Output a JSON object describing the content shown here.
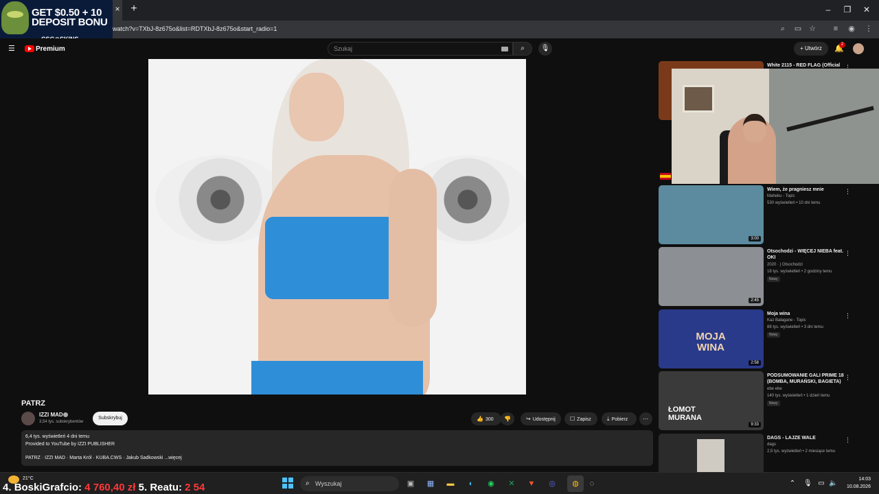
{
  "browser": {
    "url": "watch?v=TXbJ-8z675o&list=RDTXbJ-8z675o&start_radio=1",
    "new_tab_label": "+",
    "close_label": "×"
  },
  "ad": {
    "line1": "GET $0.50 + 10",
    "line2": "DEPOSIT BONU",
    "brand": "CSG⊙SKINS"
  },
  "yt_header": {
    "brand_label": "Premium",
    "search_placeholder": "Szukaj",
    "create_label": "+ Utwórz",
    "notifications_count": "2"
  },
  "video": {
    "title": "PATRZ",
    "channel": "IZZI MAD",
    "subscribers": "3,54 tys. subskrybentów",
    "subscribe_label": "Subskrybuj",
    "likes": "300",
    "share_label": "Udostępnij",
    "save_label": "Zapisz",
    "download_label": "Pobierz"
  },
  "description": {
    "line1": "6,4 tys. wyświetleń  4 dni temu",
    "line2": "Provided to YouTube by IZZI PUBLISHER",
    "line3": "PATRZ · IZZI MAD · Marta Król · KUBA.CWS · Jakub Sadkowski  ...więcej"
  },
  "sidebar": [
    {
      "title": "White 2115 - RED FLAG (Official",
      "channel": "",
      "meta": "",
      "duration": "",
      "new": "",
      "thumb_color": "#7a3a1a"
    },
    {
      "title": "Wiem, że pragniesz mnie",
      "channel": "Maheku - Topic",
      "meta": "530 wyświetleń • 10 dni temu",
      "duration": "3:00",
      "new": "",
      "thumb_color": "#5c8a9e"
    },
    {
      "title": "Otsochodzi - WIĘCEJ NIEBA feat. OKI",
      "channel": "2020 · | Otsochodzi",
      "meta": "18 tys. wyświetleń • 2 godziny temu",
      "duration": "2:45",
      "new": "Nowy",
      "thumb_color": "#8c8f93"
    },
    {
      "title": "Moja wina",
      "channel": "Kaz Bałagane - Topic",
      "meta": "88 tys. wyświetleń • 3 dni temu",
      "duration": "2:58",
      "new": "Nowy",
      "thumb_color": "#2a3a8a",
      "thumb_text": "MOJA WINA"
    },
    {
      "title": "PODSUMOWANIE GALI PRIME 18 (BOMBA, MURAŃSKI, BAGIETA)",
      "channel": "ebe ebe",
      "meta": "140 tys. wyświetleń • 1 dzień temu",
      "duration": "9:33",
      "new": "Nowy",
      "thumb_color": "#3a3a3a",
      "thumb_text": "ŁOMOT MURANA"
    },
    {
      "title": "DAGS - LAJZE WALE",
      "channel": "dags",
      "meta": "2,5 tys. wyświetleń • 2 miesiące temu",
      "duration": "",
      "new": "",
      "thumb_color": "#2b2b2b"
    }
  ],
  "taskbar": {
    "temperature": "21°C",
    "overlay_rank1": "4.",
    "overlay_name1": "BoskiGrafcio:",
    "overlay_value1": "4 760,40 zł",
    "overlay_rank2": "5.",
    "overlay_name2": "Reatu:",
    "overlay_value2": "2 54",
    "search_placeholder": "Wyszukaj",
    "time": "14:03",
    "date": "10.08.2026"
  },
  "colors": {
    "yt_bg": "#0f0f0f",
    "accent_red": "#ff0000",
    "chip_bg": "#272727"
  }
}
